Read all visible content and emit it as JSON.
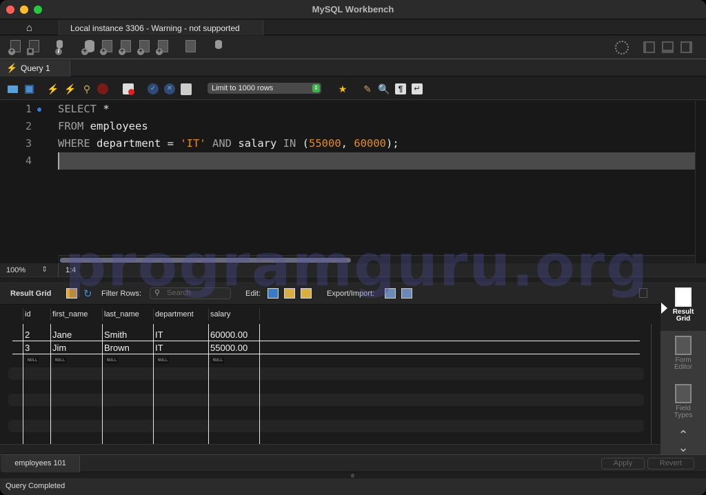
{
  "window": {
    "title": "MySQL Workbench"
  },
  "connection_tabs": {
    "home_icon": "home-icon",
    "active_tab": "Local instance 3306 - Warning - not supported"
  },
  "main_toolbar": {
    "icons": [
      "new-sql-tab-icon",
      "open-sql-script-icon",
      "server-info-icon",
      "create-schema-icon",
      "create-table-icon",
      "create-view-icon",
      "create-procedure-icon",
      "create-function-icon",
      "search-table-data-icon",
      "reconnect-icon"
    ],
    "right_icons": [
      "preferences-icon",
      "toggle-sidebar-icon",
      "toggle-output-icon",
      "toggle-secondary-sidebar-icon"
    ]
  },
  "query_tab": {
    "label": "Query 1",
    "icon": "lightning-icon"
  },
  "sql_toolbar": {
    "icons": [
      "open-file-icon",
      "save-file-icon",
      "execute-icon",
      "execute-current-icon",
      "explain-icon",
      "stop-icon",
      "toggle-error-icon",
      "commit-icon",
      "rollback-icon",
      "autocommit-icon"
    ],
    "limit_select": "Limit to 1000 rows",
    "right_icons": [
      "add-snippet-icon",
      "beautify-icon",
      "find-icon",
      "invisible-chars-icon",
      "word-wrap-icon"
    ]
  },
  "editor": {
    "lines": [
      {
        "no": "1",
        "tokens": [
          {
            "t": "SELECT",
            "c": "kw"
          },
          {
            "t": " *",
            "c": "plain"
          }
        ]
      },
      {
        "no": "2",
        "tokens": [
          {
            "t": "FROM",
            "c": "kw"
          },
          {
            "t": " employees",
            "c": "plain"
          }
        ]
      },
      {
        "no": "3",
        "tokens": [
          {
            "t": "WHERE",
            "c": "kw"
          },
          {
            "t": " department = ",
            "c": "plain"
          },
          {
            "t": "'IT'",
            "c": "str"
          },
          {
            "t": " ",
            "c": "plain"
          },
          {
            "t": "AND",
            "c": "kw"
          },
          {
            "t": " salary ",
            "c": "plain"
          },
          {
            "t": "IN",
            "c": "kw"
          },
          {
            "t": " (",
            "c": "plain"
          },
          {
            "t": "55000",
            "c": "num"
          },
          {
            "t": ", ",
            "c": "plain"
          },
          {
            "t": "60000",
            "c": "num"
          },
          {
            "t": ");",
            "c": "plain"
          }
        ]
      },
      {
        "no": "4",
        "tokens": []
      }
    ],
    "zoom": "100%",
    "cursor_pos": "1:4"
  },
  "result_toolbar": {
    "title": "Result Grid",
    "filter_label": "Filter Rows:",
    "search_placeholder": "Search",
    "edit_label": "Edit:",
    "export_label": "Export/Import:"
  },
  "result_grid": {
    "columns": [
      "id",
      "first_name",
      "last_name",
      "department",
      "salary"
    ],
    "rows": [
      [
        "2",
        "Jane",
        "Smith",
        "IT",
        "60000.00"
      ],
      [
        "3",
        "Jim",
        "Brown",
        "IT",
        "55000.00"
      ]
    ],
    "null_label": "NULL"
  },
  "right_panel": {
    "items": [
      {
        "label_1": "Result",
        "label_2": "Grid"
      },
      {
        "label_1": "Form",
        "label_2": "Editor"
      },
      {
        "label_1": "Field",
        "label_2": "Types"
      }
    ]
  },
  "bottom_tabs": {
    "tab": "employees 101",
    "apply": "Apply",
    "revert": "Revert"
  },
  "status": "Query Completed",
  "watermark": "programguru.org"
}
